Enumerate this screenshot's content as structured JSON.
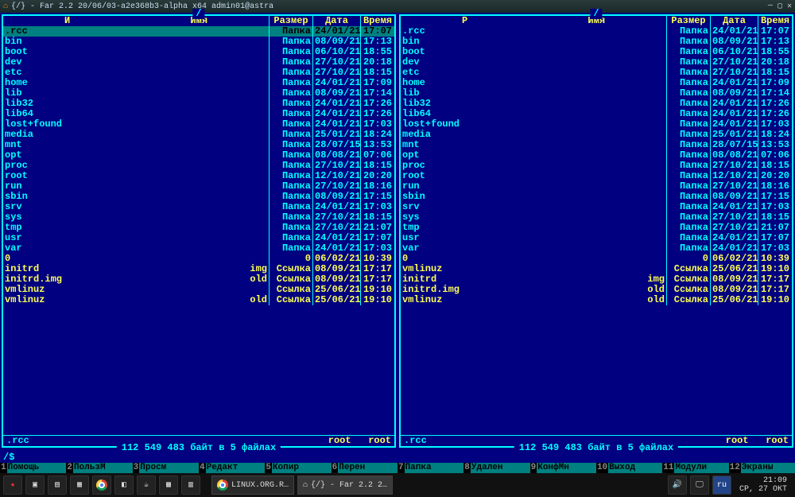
{
  "window": {
    "title": "{/} - Far 2.2 20/06/03-a2e368b3-alpha x64 admin01@astra"
  },
  "panels": [
    {
      "path": "/",
      "name_prefix": "И",
      "headers": {
        "name": "Имя",
        "size": "Размер",
        "date": "Дата",
        "time": "Время"
      },
      "selected_index": 0,
      "rows": [
        {
          "name": ".rcc",
          "ext": "",
          "size": "Папка",
          "date": "24/01/21",
          "time": "17:07",
          "link": false
        },
        {
          "name": "bin",
          "ext": "",
          "size": "Папка",
          "date": "08/09/21",
          "time": "17:13",
          "link": false
        },
        {
          "name": "boot",
          "ext": "",
          "size": "Папка",
          "date": "06/10/21",
          "time": "18:55",
          "link": false
        },
        {
          "name": "dev",
          "ext": "",
          "size": "Папка",
          "date": "27/10/21",
          "time": "20:18",
          "link": false
        },
        {
          "name": "etc",
          "ext": "",
          "size": "Папка",
          "date": "27/10/21",
          "time": "18:15",
          "link": false
        },
        {
          "name": "home",
          "ext": "",
          "size": "Папка",
          "date": "24/01/21",
          "time": "17:09",
          "link": false
        },
        {
          "name": "lib",
          "ext": "",
          "size": "Папка",
          "date": "08/09/21",
          "time": "17:14",
          "link": false
        },
        {
          "name": "lib32",
          "ext": "",
          "size": "Папка",
          "date": "24/01/21",
          "time": "17:26",
          "link": false
        },
        {
          "name": "lib64",
          "ext": "",
          "size": "Папка",
          "date": "24/01/21",
          "time": "17:26",
          "link": false
        },
        {
          "name": "lost+found",
          "ext": "",
          "size": "Папка",
          "date": "24/01/21",
          "time": "17:03",
          "link": false
        },
        {
          "name": "media",
          "ext": "",
          "size": "Папка",
          "date": "25/01/21",
          "time": "18:24",
          "link": false
        },
        {
          "name": "mnt",
          "ext": "",
          "size": "Папка",
          "date": "28/07/15",
          "time": "13:53",
          "link": false
        },
        {
          "name": "opt",
          "ext": "",
          "size": "Папка",
          "date": "08/08/21",
          "time": "07:06",
          "link": false
        },
        {
          "name": "proc",
          "ext": "",
          "size": "Папка",
          "date": "27/10/21",
          "time": "18:15",
          "link": false
        },
        {
          "name": "root",
          "ext": "",
          "size": "Папка",
          "date": "12/10/21",
          "time": "20:20",
          "link": false
        },
        {
          "name": "run",
          "ext": "",
          "size": "Папка",
          "date": "27/10/21",
          "time": "18:16",
          "link": false
        },
        {
          "name": "sbin",
          "ext": "",
          "size": "Папка",
          "date": "08/09/21",
          "time": "17:15",
          "link": false
        },
        {
          "name": "srv",
          "ext": "",
          "size": "Папка",
          "date": "24/01/21",
          "time": "17:03",
          "link": false
        },
        {
          "name": "sys",
          "ext": "",
          "size": "Папка",
          "date": "27/10/21",
          "time": "18:15",
          "link": false
        },
        {
          "name": "tmp",
          "ext": "",
          "size": "Папка",
          "date": "27/10/21",
          "time": "21:07",
          "link": false
        },
        {
          "name": "usr",
          "ext": "",
          "size": "Папка",
          "date": "24/01/21",
          "time": "17:07",
          "link": false
        },
        {
          "name": "var",
          "ext": "",
          "size": "Папка",
          "date": "24/01/21",
          "time": "17:03",
          "link": false
        },
        {
          "name": "0",
          "ext": "",
          "size": "0",
          "date": "06/02/21",
          "time": "10:39",
          "link": true
        },
        {
          "name": "initrd",
          "ext": "img",
          "size": "Ссылка",
          "date": "08/09/21",
          "time": "17:17",
          "link": true
        },
        {
          "name": "initrd.img",
          "ext": "old",
          "size": "Ссылка",
          "date": "08/09/21",
          "time": "17:17",
          "link": true
        },
        {
          "name": "vmlinuz",
          "ext": "",
          "size": "Ссылка",
          "date": "25/06/21",
          "time": "19:10",
          "link": true
        },
        {
          "name": "vmlinuz",
          "ext": "old",
          "size": "Ссылка",
          "date": "25/06/21",
          "time": "19:10",
          "link": true
        }
      ],
      "current": ".rcc",
      "owner1": "root",
      "owner2": "root",
      "summary": "112 549 483 байт в 5 файлах"
    },
    {
      "path": "/",
      "name_prefix": "Р",
      "headers": {
        "name": "Имя",
        "size": "Размер",
        "date": "Дата",
        "time": "Время"
      },
      "selected_index": -1,
      "rows": [
        {
          "name": ".rcc",
          "ext": "",
          "size": "Папка",
          "date": "24/01/21",
          "time": "17:07",
          "link": false
        },
        {
          "name": "bin",
          "ext": "",
          "size": "Папка",
          "date": "08/09/21",
          "time": "17:13",
          "link": false
        },
        {
          "name": "boot",
          "ext": "",
          "size": "Папка",
          "date": "06/10/21",
          "time": "18:55",
          "link": false
        },
        {
          "name": "dev",
          "ext": "",
          "size": "Папка",
          "date": "27/10/21",
          "time": "20:18",
          "link": false
        },
        {
          "name": "etc",
          "ext": "",
          "size": "Папка",
          "date": "27/10/21",
          "time": "18:15",
          "link": false
        },
        {
          "name": "home",
          "ext": "",
          "size": "Папка",
          "date": "24/01/21",
          "time": "17:09",
          "link": false
        },
        {
          "name": "lib",
          "ext": "",
          "size": "Папка",
          "date": "08/09/21",
          "time": "17:14",
          "link": false
        },
        {
          "name": "lib32",
          "ext": "",
          "size": "Папка",
          "date": "24/01/21",
          "time": "17:26",
          "link": false
        },
        {
          "name": "lib64",
          "ext": "",
          "size": "Папка",
          "date": "24/01/21",
          "time": "17:26",
          "link": false
        },
        {
          "name": "lost+found",
          "ext": "",
          "size": "Папка",
          "date": "24/01/21",
          "time": "17:03",
          "link": false
        },
        {
          "name": "media",
          "ext": "",
          "size": "Папка",
          "date": "25/01/21",
          "time": "18:24",
          "link": false
        },
        {
          "name": "mnt",
          "ext": "",
          "size": "Папка",
          "date": "28/07/15",
          "time": "13:53",
          "link": false
        },
        {
          "name": "opt",
          "ext": "",
          "size": "Папка",
          "date": "08/08/21",
          "time": "07:06",
          "link": false
        },
        {
          "name": "proc",
          "ext": "",
          "size": "Папка",
          "date": "27/10/21",
          "time": "18:15",
          "link": false
        },
        {
          "name": "root",
          "ext": "",
          "size": "Папка",
          "date": "12/10/21",
          "time": "20:20",
          "link": false
        },
        {
          "name": "run",
          "ext": "",
          "size": "Папка",
          "date": "27/10/21",
          "time": "18:16",
          "link": false
        },
        {
          "name": "sbin",
          "ext": "",
          "size": "Папка",
          "date": "08/09/21",
          "time": "17:15",
          "link": false
        },
        {
          "name": "srv",
          "ext": "",
          "size": "Папка",
          "date": "24/01/21",
          "time": "17:03",
          "link": false
        },
        {
          "name": "sys",
          "ext": "",
          "size": "Папка",
          "date": "27/10/21",
          "time": "18:15",
          "link": false
        },
        {
          "name": "tmp",
          "ext": "",
          "size": "Папка",
          "date": "27/10/21",
          "time": "21:07",
          "link": false
        },
        {
          "name": "usr",
          "ext": "",
          "size": "Папка",
          "date": "24/01/21",
          "time": "17:07",
          "link": false
        },
        {
          "name": "var",
          "ext": "",
          "size": "Папка",
          "date": "24/01/21",
          "time": "17:03",
          "link": false
        },
        {
          "name": "0",
          "ext": "",
          "size": "0",
          "date": "06/02/21",
          "time": "10:39",
          "link": true
        },
        {
          "name": "vmlinuz",
          "ext": "",
          "size": "Ссылка",
          "date": "25/06/21",
          "time": "19:10",
          "link": true
        },
        {
          "name": "initrd",
          "ext": "img",
          "size": "Ссылка",
          "date": "08/09/21",
          "time": "17:17",
          "link": true
        },
        {
          "name": "initrd.img",
          "ext": "old",
          "size": "Ссылка",
          "date": "08/09/21",
          "time": "17:17",
          "link": true
        },
        {
          "name": "vmlinuz",
          "ext": "old",
          "size": "Ссылка",
          "date": "25/06/21",
          "time": "19:10",
          "link": true
        }
      ],
      "current": ".rcc",
      "owner1": "root",
      "owner2": "root",
      "summary": "112 549 483 байт в 5 файлах"
    }
  ],
  "cmdline": "/$",
  "keybar": [
    {
      "n": "1",
      "l": "Помощь"
    },
    {
      "n": "2",
      "l": "ПользМ"
    },
    {
      "n": "3",
      "l": "Просм"
    },
    {
      "n": "4",
      "l": "Редакт"
    },
    {
      "n": "5",
      "l": "Копир"
    },
    {
      "n": "6",
      "l": "Перен"
    },
    {
      "n": "7",
      "l": "Папка"
    },
    {
      "n": "8",
      "l": "Удален"
    },
    {
      "n": "9",
      "l": "КонфМн"
    },
    {
      "n": "10",
      "l": "Выход"
    },
    {
      "n": "11",
      "l": "Модули"
    },
    {
      "n": "12",
      "l": "Экраны"
    }
  ],
  "taskbar": {
    "tasks": [
      {
        "label": "LINUX.ORG.R…"
      },
      {
        "label": "{/} - Far 2.2 2…"
      }
    ],
    "clock_time": "21:09",
    "clock_date": "СР, 27 ОКТ"
  }
}
